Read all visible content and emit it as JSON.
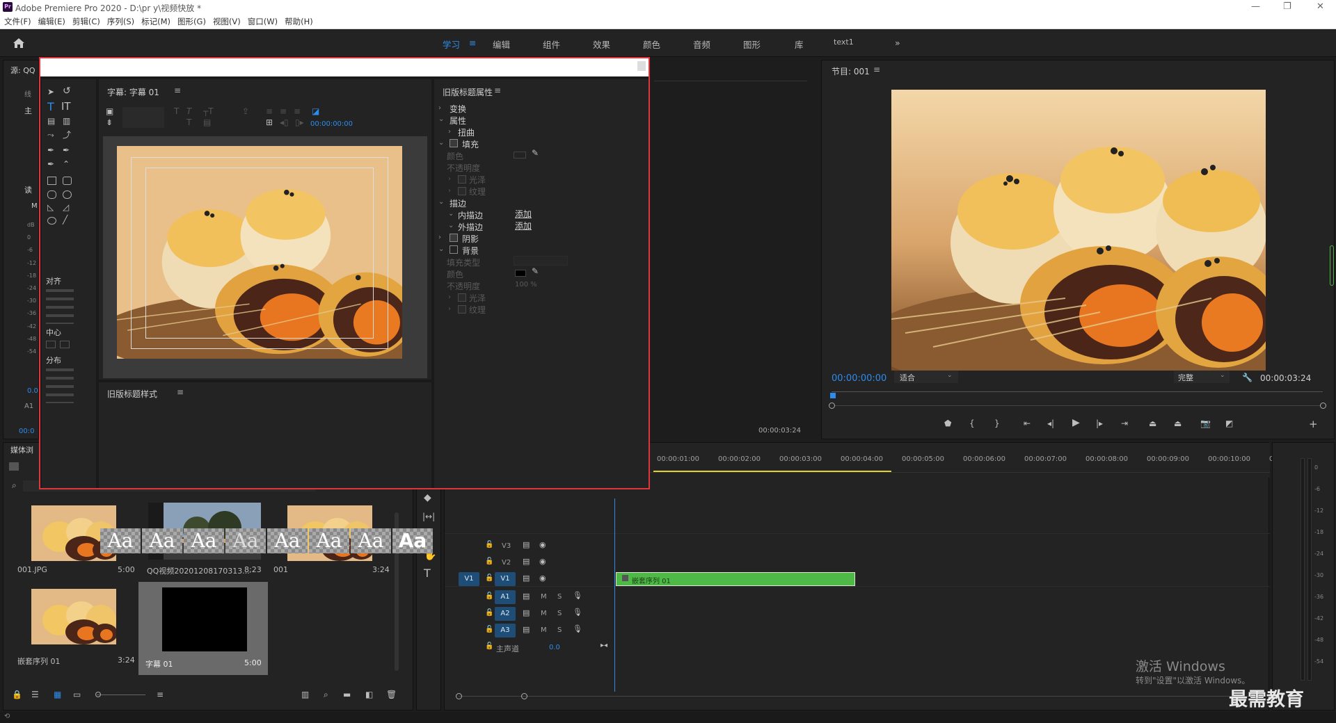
{
  "window": {
    "title": "Adobe Premiere Pro 2020 - D:\\pr y\\视频快放 *",
    "logo_text": "Pr",
    "controls": [
      "—",
      "❐",
      "✕"
    ]
  },
  "menu": [
    "文件(F)",
    "编辑(E)",
    "剪辑(C)",
    "序列(S)",
    "标记(M)",
    "图形(G)",
    "视图(V)",
    "窗口(W)",
    "帮助(H)"
  ],
  "workspaces": [
    "学习",
    "编辑",
    "组件",
    "效果",
    "颜色",
    "音频",
    "图形",
    "库",
    "text1"
  ],
  "active_workspace": "学习",
  "source_panel": {
    "tab": "源: QQ",
    "labels": [
      "线",
      "主",
      "读",
      "M"
    ],
    "db_ticks": [
      "dB",
      "0",
      "-6",
      "-12",
      "-18",
      "-24",
      "-30",
      "-36",
      "-42",
      "-48",
      "-54"
    ],
    "level": "0.0",
    "track_label": "A1",
    "timecode": "00:0"
  },
  "project_panel": {
    "tab": "媒体浏",
    "items": [
      {
        "name": "001.JPG",
        "duration": "5:00"
      },
      {
        "name": "QQ视频20201208170313...",
        "duration": "8;23"
      },
      {
        "name": "001",
        "duration": "3:24"
      },
      {
        "name": "嵌套序列 01",
        "duration": "3:24"
      },
      {
        "name": "字幕 01",
        "duration": "5:00"
      }
    ]
  },
  "title_dialog": {
    "title_panel_tab": "字幕: 字幕 01",
    "timecode": "00:00:00:00",
    "tools_sections": [
      "对齐",
      "中心",
      "分布"
    ],
    "styles_panel": "旧版标题样式",
    "style_swatch_text": "Aa",
    "properties_panel": "旧版标题属性",
    "properties": {
      "transform": "变换",
      "attributes": "属性",
      "distort": "扭曲",
      "fill": "填充",
      "color": "颜色",
      "opacity": "不透明度",
      "sheen": "光泽",
      "texture": "纹理",
      "strokes": "描边",
      "inner_stroke": "内描边",
      "outer_stroke": "外描边",
      "add": "添加",
      "shadow": "阴影",
      "background": "背景",
      "fill_type": "填充类型",
      "bg_color": "颜色",
      "bg_opacity": "不透明度",
      "bg_opacity_value": "100 %",
      "bg_sheen": "光泽",
      "bg_texture": "纹理"
    }
  },
  "program_monitor": {
    "tab": "节目: 001",
    "current_time": "00:00:00:00",
    "fit": "适合",
    "quality": "完整",
    "duration": "00:00:03:24"
  },
  "source_monitor_duration": "00:00:03:24",
  "timeline": {
    "ruler": [
      "00:00:01:00",
      "00:00:02:00",
      "00:00:03:00",
      "00:00:04:00",
      "00:00:05:00",
      "00:00:06:00",
      "00:00:07:00",
      "00:00:08:00",
      "00:00:09:00",
      "00:00:10:00",
      "00"
    ],
    "video_tracks": [
      "V3",
      "V2",
      "V1"
    ],
    "audio_tracks": [
      "A1",
      "A2",
      "A3"
    ],
    "master": "主声道",
    "master_value": "0.0",
    "source_patch": "V1",
    "clip_name": "嵌套序列 01",
    "track_buttons": {
      "mute": "M",
      "solo": "S"
    }
  },
  "audio_meter_ticks": [
    "0",
    "-6",
    "-12",
    "-18",
    "-24",
    "-30",
    "-36",
    "-42",
    "-48",
    "-54"
  ],
  "watermark": {
    "line1": "激活 Windows",
    "line2": "转到\"设置\"以激活 Windows。",
    "brand": "最需教育"
  },
  "colors": {
    "accent": "#2d8ceb",
    "highlight_box": "#e0353b",
    "clip_green": "#4fb947",
    "panel_bg": "#232323"
  }
}
